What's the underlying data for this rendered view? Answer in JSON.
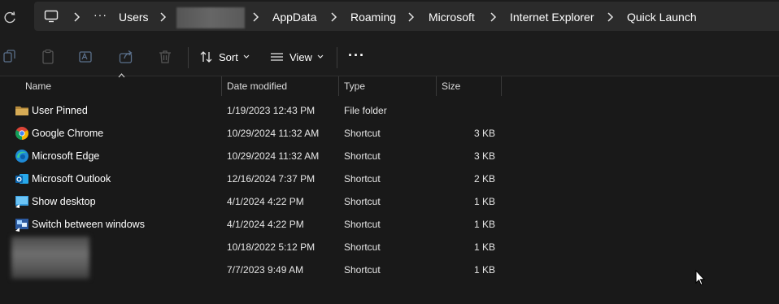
{
  "address_bar": {
    "more_label": "···",
    "crumbs": [
      "Users",
      "AppData",
      "Roaming",
      "Microsoft",
      "Internet Explorer",
      "Quick Launch"
    ]
  },
  "toolbar": {
    "sort_label": "Sort",
    "view_label": "View",
    "more_label": "···"
  },
  "columns": {
    "name": "Name",
    "date": "Date modified",
    "type": "Type",
    "size": "Size"
  },
  "files": [
    {
      "name": "User Pinned",
      "date": "1/19/2023 12:43 PM",
      "type": "File folder",
      "size": "",
      "icon": "folder-icon"
    },
    {
      "name": "Google Chrome",
      "date": "10/29/2024 11:32 AM",
      "type": "Shortcut",
      "size": "3 KB",
      "icon": "chrome-icon"
    },
    {
      "name": "Microsoft Edge",
      "date": "10/29/2024 11:32 AM",
      "type": "Shortcut",
      "size": "3 KB",
      "icon": "edge-icon"
    },
    {
      "name": "Microsoft Outlook",
      "date": "12/16/2024 7:37 PM",
      "type": "Shortcut",
      "size": "2 KB",
      "icon": "outlook-icon"
    },
    {
      "name": "Show desktop",
      "date": "4/1/2024 4:22 PM",
      "type": "Shortcut",
      "size": "1 KB",
      "icon": "show-desktop-icon"
    },
    {
      "name": "Switch between windows",
      "date": "4/1/2024 4:22 PM",
      "type": "Shortcut",
      "size": "1 KB",
      "icon": "switch-windows-icon"
    },
    {
      "name": "",
      "date": "10/18/2022 5:12 PM",
      "type": "Shortcut",
      "size": "1 KB",
      "icon": ""
    },
    {
      "name": "",
      "date": "7/7/2023 9:49 AM",
      "type": "Shortcut",
      "size": "1 KB",
      "icon": ""
    }
  ],
  "colors": {
    "background": "#191919",
    "address_bar": "#2b2b2b",
    "folder": "#c8a050"
  }
}
